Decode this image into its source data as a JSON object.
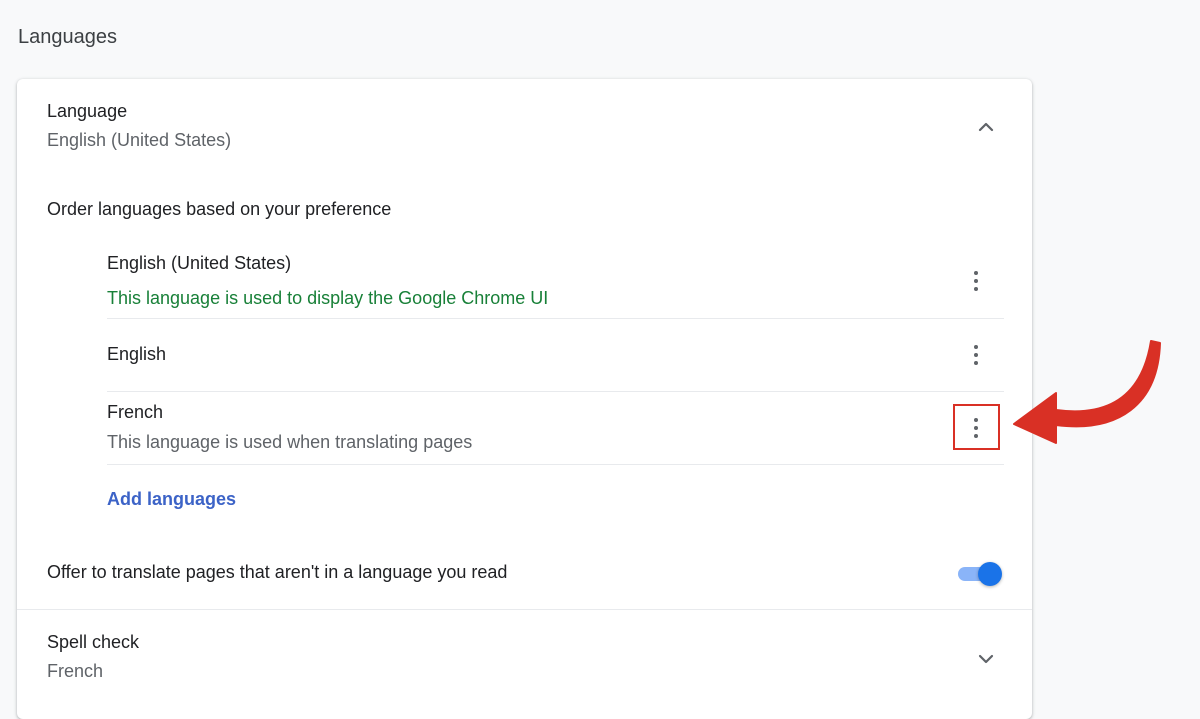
{
  "page": {
    "section_title": "Languages"
  },
  "language_section": {
    "title": "Language",
    "subtitle": "English (United States)",
    "collapse_icon": "chevron-up-icon",
    "order_label": "Order languages based on your preference",
    "languages": [
      {
        "name": "English (United States)",
        "note": "This language is used to display the Google Chrome UI",
        "note_color": "#188038"
      },
      {
        "name": "English",
        "note": ""
      },
      {
        "name": "French",
        "note": "This language is used when translating pages",
        "note_color": "#5f6368"
      }
    ],
    "more_icon": "more-vert-icon",
    "add_languages_label": "Add languages",
    "offer_translate_label": "Offer to translate pages that aren't in a language you read",
    "offer_translate_enabled": true
  },
  "spell_check": {
    "title": "Spell check",
    "subtitle": "French",
    "expand_icon": "chevron-down-icon"
  },
  "annotation": {
    "highlight_color": "#d93025",
    "arrow_color": "#d93025",
    "arrow_icon": "curved-arrow-icon"
  },
  "colors": {
    "accent": "#1a73e8",
    "link": "#3c63c7",
    "background": "#f8f9fa"
  }
}
